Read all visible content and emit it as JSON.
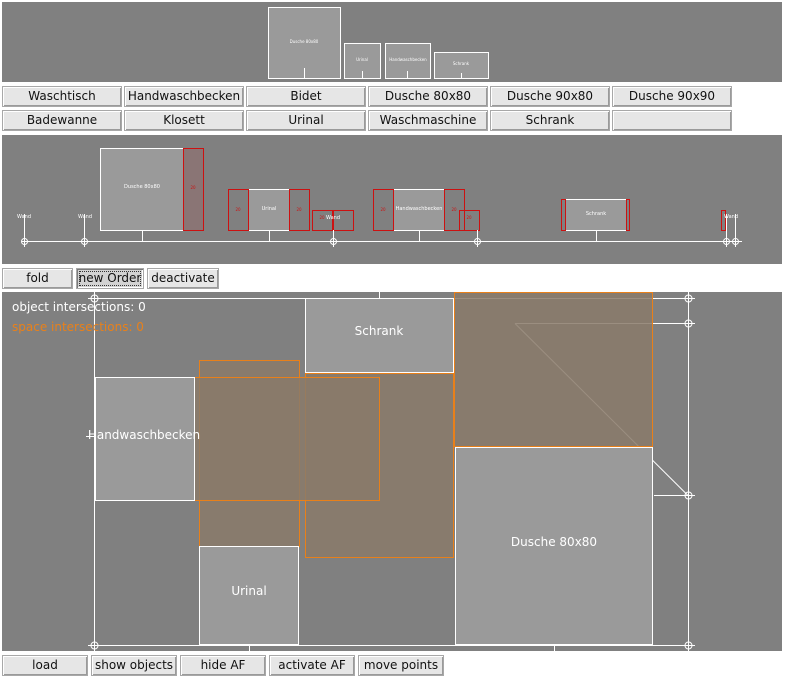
{
  "palette": {
    "items": [
      "Dusche 80x80",
      "Urinal",
      "Handwaschbecken",
      "Schrank"
    ]
  },
  "toolbar_top": {
    "row1": [
      "Waschtisch",
      "Handwaschbecken",
      "Bidet",
      "Dusche 80x80",
      "Dusche 90x80",
      "Dusche 90x90"
    ],
    "row2": [
      "Badewanne",
      "Klosett",
      "Urinal",
      "Waschmaschine",
      "Schrank",
      ""
    ]
  },
  "elevation": {
    "wall_left_1": "Wand",
    "wall_left_2": "Wand",
    "wall_right": "Wand",
    "dusche_label": "Dusche 80x80",
    "urinal_label": "Urinal",
    "handwaschbecken_label": "Handwaschbecken",
    "waschm_label": "Wand",
    "schrank_label": "Schrank",
    "dim_label": "20",
    "dim_label_right": "20",
    "dim_label_hwb_left": "20",
    "dim_label_hwb_right": "20",
    "dim_label_urinal_left": "20",
    "dim_label_urinal_right": "20",
    "dim_label_wand": "20"
  },
  "toolbar_mid": {
    "fold": "fold",
    "new_order": "new Order",
    "deactivate": "deactivate"
  },
  "plan": {
    "object_intersections": "object intersections: 0",
    "space_intersections": "space intersections: 0",
    "schrank": "Schrank",
    "handwaschbecken": "Handwaschbecken",
    "dusche": "Dusche 80x80",
    "urinal": "Urinal",
    "colors": {
      "space_orange": "#e8801a",
      "object_fill": "#9a9a9a",
      "background": "#808080"
    }
  },
  "toolbar_bottom": {
    "load": "load",
    "show_objects": "show objects",
    "hide_af": "hide AF",
    "activate_af": "activate AF",
    "move_points": "move points"
  }
}
